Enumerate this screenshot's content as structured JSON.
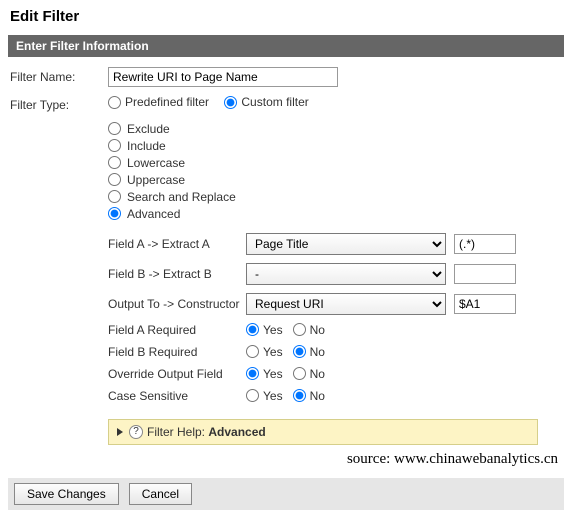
{
  "page_title": "Edit Filter",
  "section_title": "Enter Filter Information",
  "labels": {
    "filter_name": "Filter Name:",
    "filter_type": "Filter Type:"
  },
  "filter_name_value": "Rewrite URI to Page Name",
  "filter_type": {
    "predefined_label": "Predefined filter",
    "custom_label": "Custom filter",
    "selected": "custom"
  },
  "custom_options": [
    {
      "label": "Exclude",
      "selected": false
    },
    {
      "label": "Include",
      "selected": false
    },
    {
      "label": "Lowercase",
      "selected": false
    },
    {
      "label": "Uppercase",
      "selected": false
    },
    {
      "label": "Search and Replace",
      "selected": false
    },
    {
      "label": "Advanced",
      "selected": true
    }
  ],
  "advanced": {
    "field_a_label": "Field A -> Extract A",
    "field_a_select": "Page Title",
    "field_a_pattern": "(.*)",
    "field_b_label": "Field B -> Extract B",
    "field_b_select": "-",
    "field_b_pattern": "",
    "output_label": "Output To -> Constructor",
    "output_select": "Request URI",
    "output_pattern": "$A1",
    "yes": "Yes",
    "no": "No",
    "field_a_required_label": "Field A Required",
    "field_a_required": "yes",
    "field_b_required_label": "Field B Required",
    "field_b_required": "no",
    "override_label": "Override Output Field",
    "override": "yes",
    "case_label": "Case Sensitive",
    "case_sensitive": "no"
  },
  "help": {
    "label_prefix": "Filter Help:",
    "label_suffix": "Advanced"
  },
  "source_text": "source: www.chinawebanalytics.cn",
  "buttons": {
    "save": "Save Changes",
    "cancel": "Cancel"
  }
}
